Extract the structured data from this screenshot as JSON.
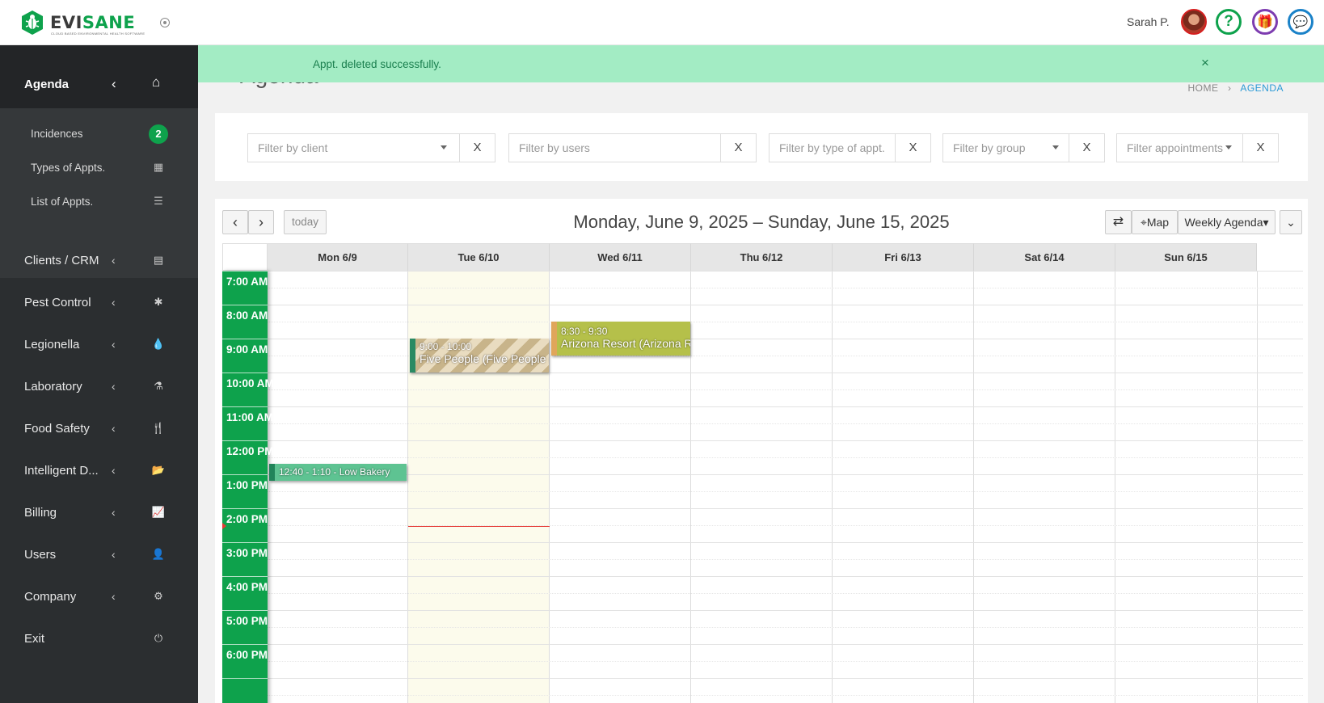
{
  "brand": {
    "name_a": "EVI",
    "name_b": "SANE",
    "tagline": "CLOUD BASED ENVIRONMENTAL HEALTH SOFTWARE"
  },
  "header": {
    "user": "Sarah P.",
    "help": "?",
    "gift": "🎁",
    "chat": "💬"
  },
  "sidebar": {
    "active": {
      "label": "Agenda",
      "chevron": "‹",
      "icon": "⌂"
    },
    "sub_items": [
      {
        "label": "Incidences",
        "badge": "2"
      },
      {
        "label": "Types of Appts.",
        "icon": "▦"
      },
      {
        "label": "List of Appts.",
        "icon": "☰"
      }
    ],
    "items": [
      {
        "label": "Clients / CRM",
        "icon": "▤"
      },
      {
        "label": "Pest Control",
        "icon": "✱"
      },
      {
        "label": "Legionella",
        "icon": "💧"
      },
      {
        "label": "Laboratory",
        "icon": "⚗"
      },
      {
        "label": "Food Safety",
        "icon": "🍴"
      },
      {
        "label": "Intelligent D...",
        "icon": "📂"
      },
      {
        "label": "Billing",
        "icon": "📈"
      },
      {
        "label": "Users",
        "icon": "👤"
      },
      {
        "label": "Company",
        "icon": "⚙"
      },
      {
        "label": "Exit",
        "icon": "⏻"
      }
    ],
    "chevron": "‹"
  },
  "page": {
    "title": "Agenda",
    "breadcrumb_home": "HOME",
    "breadcrumb_sep": "›",
    "breadcrumb_current": "AGENDA"
  },
  "alert": {
    "message": "Appt. deleted successfully.",
    "close": "×"
  },
  "filters": {
    "client_placeholder": "Filter by client",
    "users_placeholder": "Filter by users",
    "type_placeholder": "Filter by type of appt.",
    "group_placeholder": "Filter by group",
    "appointments_placeholder": "Filter appointments",
    "clear": "X"
  },
  "calendar": {
    "prev": "‹",
    "next": "›",
    "today": "today",
    "title": "Monday, June 9, 2025 – Sunday, June 15, 2025",
    "swap_icon": "⇄",
    "map_label": "Map",
    "map_icon": "⌖",
    "view_label": "Weekly Agenda",
    "view_caret": "▾",
    "more_icon": "⌄",
    "days": [
      "Mon 6/9",
      "Tue 6/10",
      "Wed 6/11",
      "Thu 6/12",
      "Fri 6/13",
      "Sat 6/14",
      "Sun 6/15"
    ],
    "times": [
      "7:00 AM",
      "8:00 AM",
      "9:00 AM",
      "10:00 AM",
      "11:00 AM",
      "12:00 PM",
      "1:00 PM",
      "2:00 PM",
      "3:00 PM",
      "4:00 PM",
      "5:00 PM",
      "6:00 PM"
    ],
    "events": [
      {
        "time": "9:00 - 10:00",
        "title": "Five People (Five People (d)...",
        "day": "Tue 6/10"
      },
      {
        "time": "8:30 - 9:30",
        "title": "Arizona Resort (Arizona Resort)",
        "day": "Wed 6/11"
      },
      {
        "time": "12:40 - 1:10 - Low Bakery",
        "title": "",
        "day": "Mon 6/9"
      }
    ]
  },
  "colors": {
    "brand": "#0ea24c",
    "sidebar": "#2b2e30",
    "alert_bg": "#a3ecc4",
    "link": "#2b9ad6"
  }
}
